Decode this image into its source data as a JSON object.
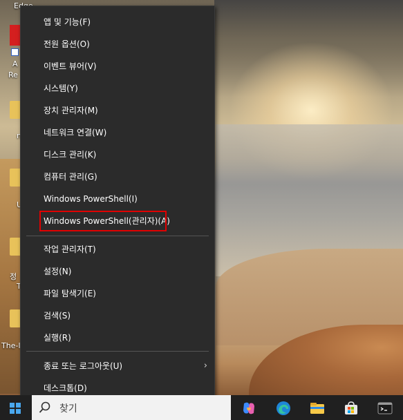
{
  "desktop": {
    "icons": [
      {
        "label": "Edge",
        "kind": "edge"
      },
      {
        "label": "A",
        "kind": "acrobat"
      },
      {
        "label": "Re",
        "kind": "acrobat-label2"
      },
      {
        "label": "n",
        "kind": "folder"
      },
      {
        "label": "U",
        "kind": "folder"
      },
      {
        "label": "정",
        "kind": "folder"
      },
      {
        "label": "T",
        "kind": "folder"
      },
      {
        "label": "The-I",
        "kind": "folder"
      }
    ]
  },
  "menu": {
    "group1": [
      {
        "label": "앱 및 기능(F)"
      },
      {
        "label": "전원 옵션(O)"
      },
      {
        "label": "이벤트 뷰어(V)"
      },
      {
        "label": "시스템(Y)"
      },
      {
        "label": "장치 관리자(M)"
      },
      {
        "label": "네트워크 연결(W)"
      },
      {
        "label": "디스크 관리(K)"
      },
      {
        "label": "컴퓨터 관리(G)"
      },
      {
        "label": "Windows PowerShell(I)"
      },
      {
        "label": "Windows PowerShell(관리자)(A)"
      }
    ],
    "group2": [
      {
        "label": "작업 관리자(T)"
      },
      {
        "label": "설정(N)"
      },
      {
        "label": "파일 탐색기(E)"
      },
      {
        "label": "검색(S)"
      },
      {
        "label": "실행(R)"
      }
    ],
    "group3": [
      {
        "label": "종료 또는 로그아웃(U)",
        "submenu_icon": "chevron-right-icon"
      },
      {
        "label": "데스크톱(D)"
      }
    ],
    "highlight_color": "#e00000"
  },
  "taskbar": {
    "search_placeholder": "찾기",
    "apps": [
      {
        "name": "copilot-icon"
      },
      {
        "name": "edge-icon"
      },
      {
        "name": "file-explorer-icon"
      },
      {
        "name": "microsoft-store-icon"
      },
      {
        "name": "terminal-icon"
      }
    ]
  }
}
